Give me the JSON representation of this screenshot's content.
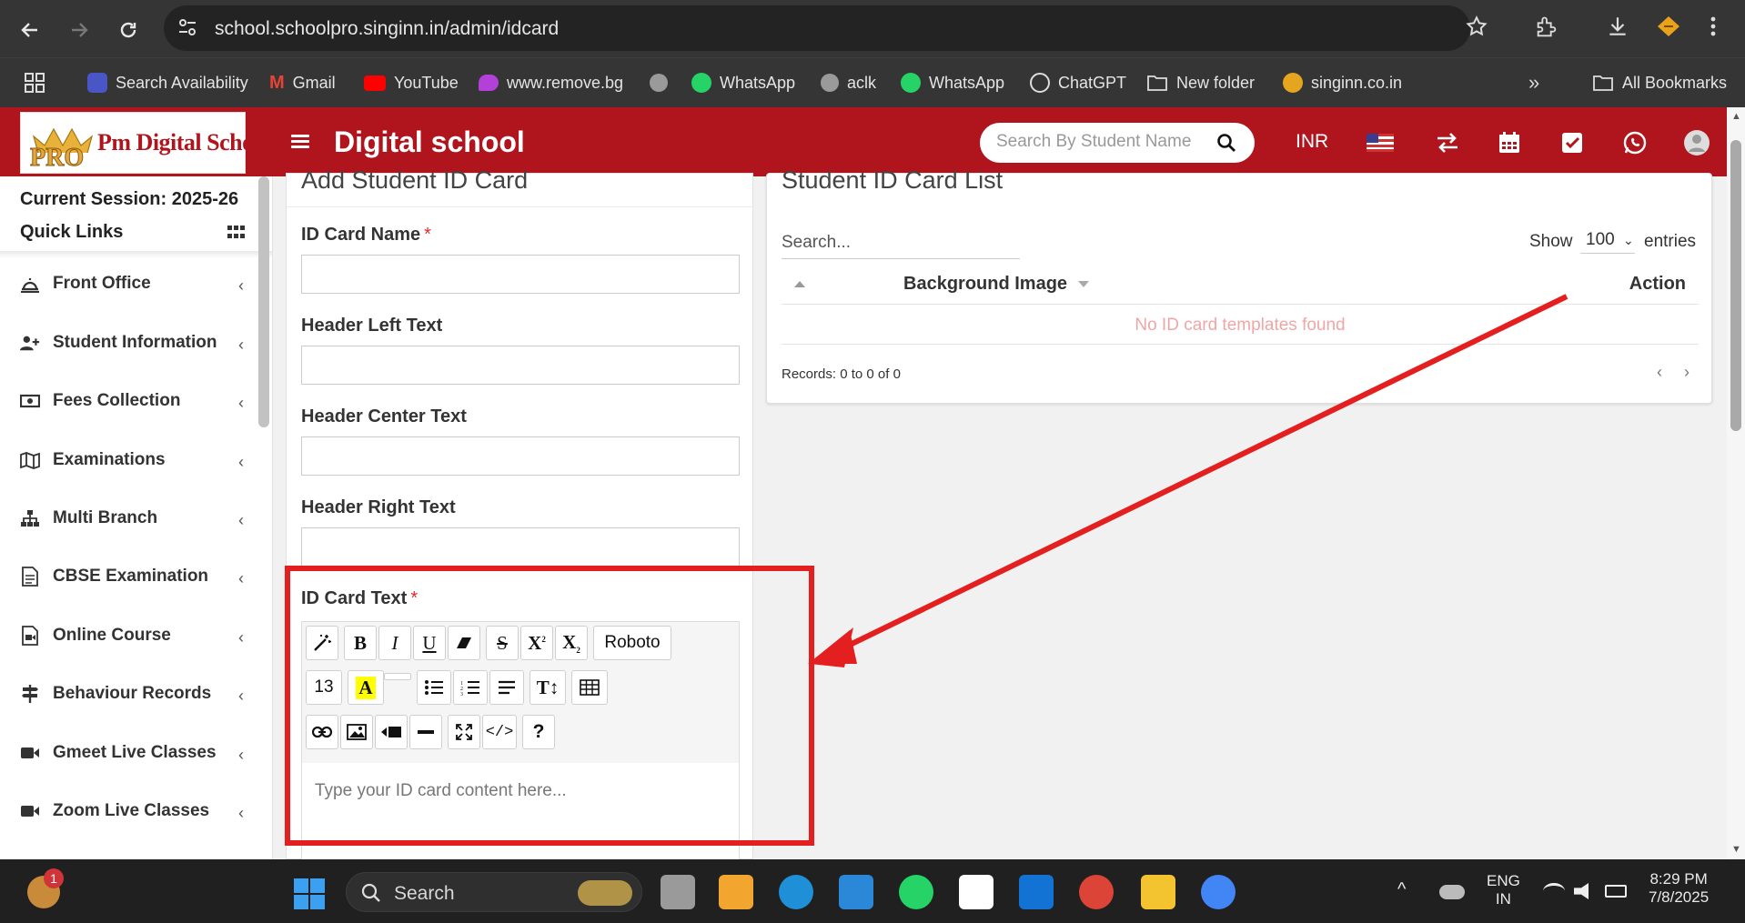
{
  "browser": {
    "url": "school.schoolpro.singinn.in/admin/idcard",
    "bookmarks": [
      "Search Availability",
      "Gmail",
      "YouTube",
      "www.remove.bg",
      "WhatsApp",
      "aclk",
      "WhatsApp",
      "ChatGPT",
      "New folder",
      "singinn.co.in"
    ],
    "all_bookmarks": "All Bookmarks"
  },
  "header": {
    "logo_text": "Pm Digital School",
    "logo_badge": "PRO",
    "title": "Digital school",
    "search_placeholder": "Search By Student Name",
    "currency": "INR"
  },
  "sidebar": {
    "session": "Current Session: 2025-26",
    "quick_links": "Quick Links",
    "items": [
      {
        "label": "Front Office",
        "icon": "reception-icon"
      },
      {
        "label": "Student Information",
        "icon": "user-plus-icon"
      },
      {
        "label": "Fees Collection",
        "icon": "money-icon"
      },
      {
        "label": "Examinations",
        "icon": "map-icon"
      },
      {
        "label": "Multi Branch",
        "icon": "sitemap-icon"
      },
      {
        "label": "CBSE Examination",
        "icon": "document-icon"
      },
      {
        "label": "Online Course",
        "icon": "file-video-icon"
      },
      {
        "label": "Behaviour Records",
        "icon": "signpost-icon"
      },
      {
        "label": "Gmeet Live Classes",
        "icon": "video-icon"
      },
      {
        "label": "Zoom Live Classes",
        "icon": "video-icon"
      }
    ]
  },
  "form": {
    "title": "Add Student ID Card",
    "fields": [
      {
        "label": "ID Card Name",
        "required": "*"
      },
      {
        "label": "Header Left Text",
        "required": ""
      },
      {
        "label": "Header Center Text",
        "required": ""
      },
      {
        "label": "Header Right Text",
        "required": ""
      }
    ],
    "editor_label": "ID Card Text",
    "editor_required": "*",
    "font_name": "Roboto",
    "font_size": "13",
    "editor_placeholder": "Type your ID card content here..."
  },
  "list": {
    "title": "Student ID Card List",
    "search_placeholder": "Search...",
    "show_label": "Show",
    "entries_value": "100",
    "entries_label": "entries",
    "col_background": "Background Image",
    "col_action": "Action",
    "empty_message": "No ID card templates found",
    "records": "Records: 0 to 0 of 0"
  },
  "taskbar": {
    "search_label": "Search",
    "notification_count": "1",
    "language": "ENG",
    "region": "IN",
    "time": "8:29 PM",
    "date": "7/8/2025"
  },
  "colors": {
    "brand": "#b0151d",
    "annotation": "#e41f1f"
  }
}
